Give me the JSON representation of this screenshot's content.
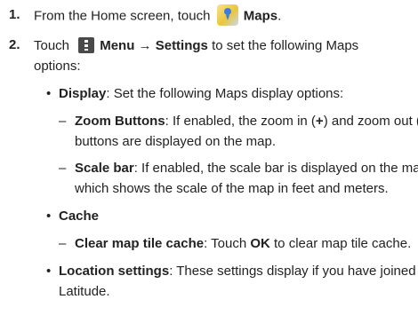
{
  "step1": {
    "number": "1.",
    "text_before": "From the Home screen, touch",
    "maps_label": "Maps",
    "period": "."
  },
  "step2": {
    "number": "2.",
    "touch": "Touch",
    "menu_label": "Menu",
    "arrow": "→",
    "settings_label": "Settings",
    "text_after": "to set the following Maps",
    "text_line2": "options:"
  },
  "display": {
    "bullet": "•",
    "label": "Display",
    "text": ": Set the following Maps display options:"
  },
  "zoom": {
    "dash": "–",
    "label": "Zoom Buttons",
    "text1": ": If enabled, the zoom in (",
    "plus": "+",
    "text2": ") and zoom out (",
    "minus": "-",
    "text3": ")",
    "text_line2": "buttons are displayed on the map."
  },
  "scale": {
    "dash": "–",
    "label": "Scale bar",
    "text1": ": If enabled, the scale bar is displayed on the map,",
    "text_line2": "which shows the scale of the map in feet and meters."
  },
  "cache": {
    "bullet": "•",
    "label": "Cache"
  },
  "clear": {
    "dash": "–",
    "label": "Clear map tile cache",
    "text1": ": Touch",
    "ok": "OK",
    "text2": "to clear map tile cache."
  },
  "location": {
    "bullet": "•",
    "label": "Location settings",
    "text1": ": These settings display if you have joined",
    "text_line2": "Latitude."
  },
  "icons": {
    "maps": "maps-icon",
    "menu": "menu-icon"
  }
}
